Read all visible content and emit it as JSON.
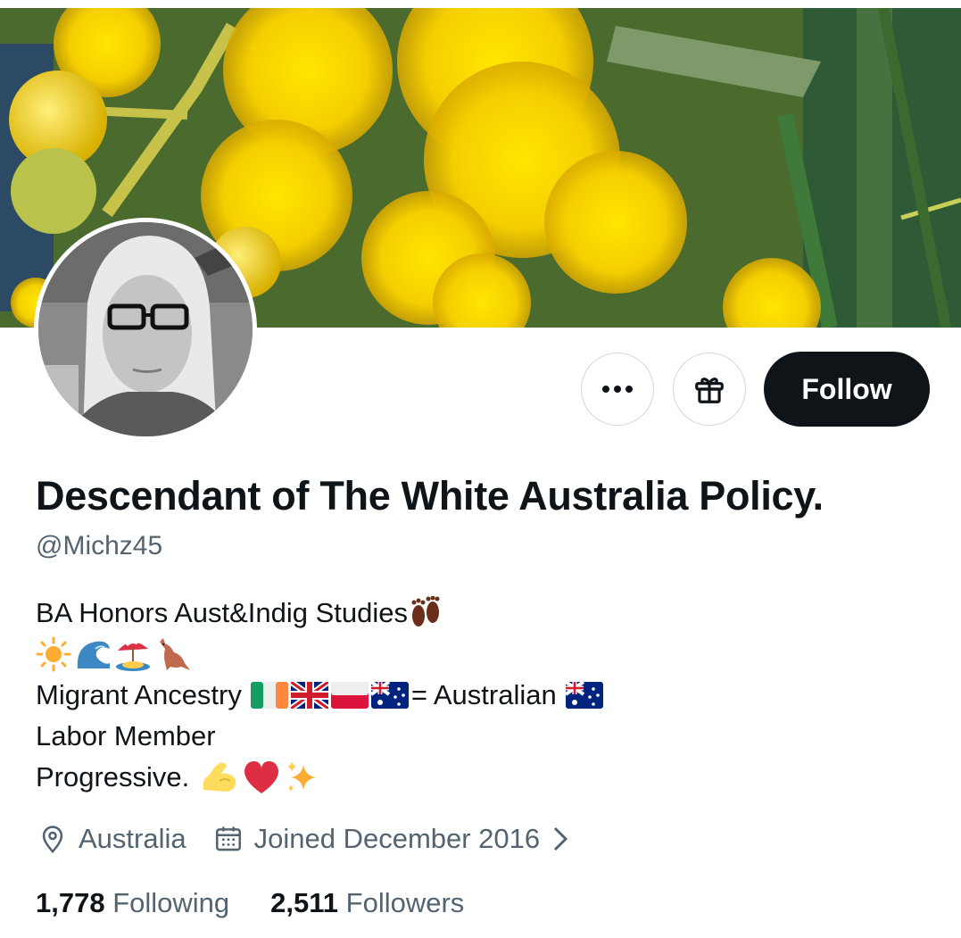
{
  "profile": {
    "display_name": "Descendant of The White Australia Policy.",
    "handle": "@Michz45",
    "bio": {
      "line1": "BA Honors Aust&Indig Studies",
      "line1_emoji": "footprints-icon",
      "line2_emojis": [
        "sun-icon",
        "wave-icon",
        "beach-umbrella-icon",
        "kangaroo-icon"
      ],
      "line3_prefix": "Migrant Ancestry",
      "line3_flags": [
        "ireland-flag-icon",
        "uk-flag-icon",
        "poland-flag-icon",
        "australia-flag-icon"
      ],
      "line3_suffix": "= Australian",
      "line4": "Labor Member",
      "line5": "Progressive.",
      "line5_emojis": [
        "flexed-biceps-icon",
        "red-heart-icon",
        "sparkles-icon"
      ]
    },
    "location": "Australia",
    "joined": "Joined December 2016",
    "following_count": "1,778",
    "following_label": "Following",
    "followers_count": "2,511",
    "followers_label": "Followers"
  },
  "actions": {
    "follow_label": "Follow",
    "more_icon": "more-icon",
    "gift_icon": "gift-icon"
  },
  "colors": {
    "text_primary": "#0f1419",
    "text_secondary": "#536471",
    "follow_bg": "#0f1419",
    "border": "#cfd9de"
  }
}
